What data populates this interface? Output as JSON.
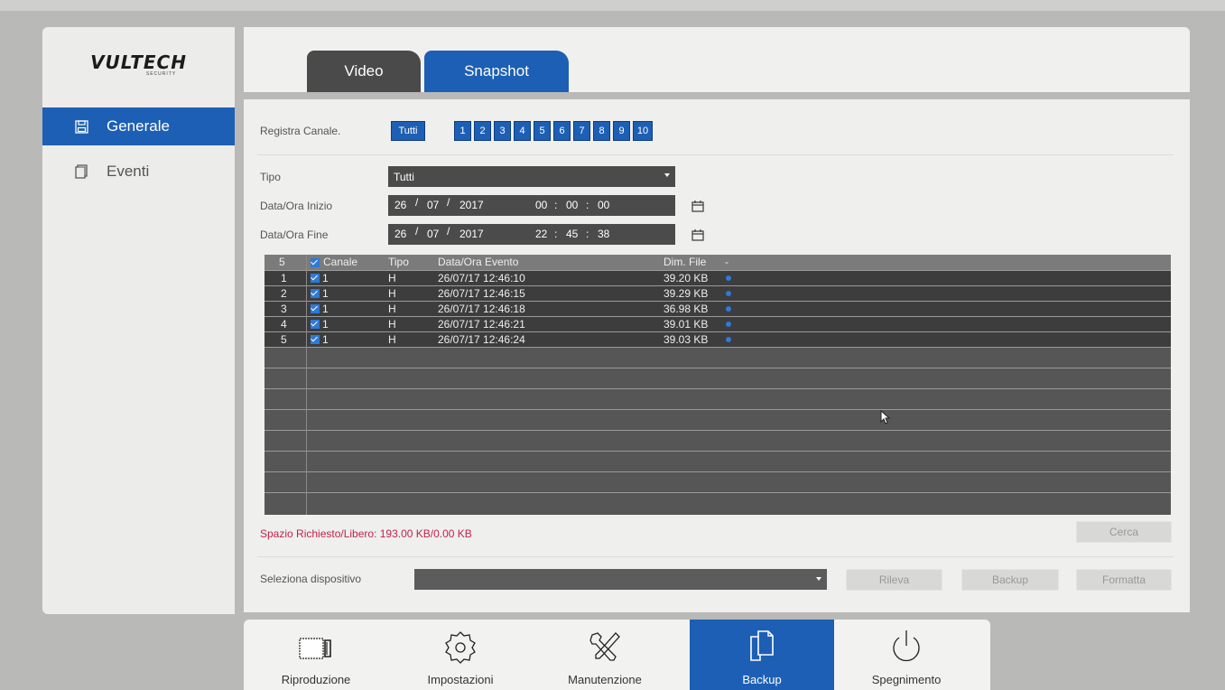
{
  "brand": {
    "logo": "VULTECH",
    "sub": "SECURITY"
  },
  "sidebar": {
    "items": [
      {
        "label": "Generale",
        "icon": "floppy-icon"
      },
      {
        "label": "Eventi",
        "icon": "document-icon"
      }
    ]
  },
  "tabs": [
    {
      "label": "Video"
    },
    {
      "label": "Snapshot"
    }
  ],
  "form": {
    "channels_label": "Registra Canale.",
    "channels_all": "Tutti",
    "channels": [
      "1",
      "2",
      "3",
      "4",
      "5",
      "6",
      "7",
      "8",
      "9",
      "10"
    ],
    "type_label": "Tipo",
    "type_value": "Tutti",
    "start_label": "Data/Ora Inizio",
    "start": {
      "day": "26",
      "month": "07",
      "year": "2017",
      "h": "00",
      "m": "00",
      "s": "00"
    },
    "end_label": "Data/Ora Fine",
    "end": {
      "day": "26",
      "month": "07",
      "year": "2017",
      "h": "22",
      "m": "45",
      "s": "38"
    },
    "sep_slash": "/",
    "sep_colon": ":"
  },
  "table": {
    "headers": {
      "count": "5",
      "channel": "Canale",
      "type": "Tipo",
      "datetime": "Data/Ora Evento",
      "size": "Dim. File",
      "extra": "-"
    },
    "rows": [
      {
        "n": "1",
        "channel": "1",
        "type": "H",
        "datetime": "26/07/17 12:46:10",
        "size": "39.20 KB"
      },
      {
        "n": "2",
        "channel": "1",
        "type": "H",
        "datetime": "26/07/17 12:46:15",
        "size": "39.29 KB"
      },
      {
        "n": "3",
        "channel": "1",
        "type": "H",
        "datetime": "26/07/17 12:46:18",
        "size": "36.98 KB"
      },
      {
        "n": "4",
        "channel": "1",
        "type": "H",
        "datetime": "26/07/17 12:46:21",
        "size": "39.01 KB"
      },
      {
        "n": "5",
        "channel": "1",
        "type": "H",
        "datetime": "26/07/17 12:46:24",
        "size": "39.03 KB"
      }
    ]
  },
  "status": {
    "space": "Spazio Richiesto/Libero: 193.00 KB/0.00 KB"
  },
  "buttons": {
    "search": "Cerca",
    "detect": "Rileva",
    "backup": "Backup",
    "format": "Formatta"
  },
  "device": {
    "label": "Seleziona dispositivo"
  },
  "bottom": [
    {
      "label": "Riproduzione",
      "icon": "playback-icon"
    },
    {
      "label": "Impostazioni",
      "icon": "gear-icon"
    },
    {
      "label": "Manutenzione",
      "icon": "tools-icon"
    },
    {
      "label": "Backup",
      "icon": "backup-icon"
    },
    {
      "label": "Spegnimento",
      "icon": "power-icon"
    }
  ],
  "colors": {
    "accent": "#1d5fb4",
    "warning_text": "#c0234a"
  }
}
